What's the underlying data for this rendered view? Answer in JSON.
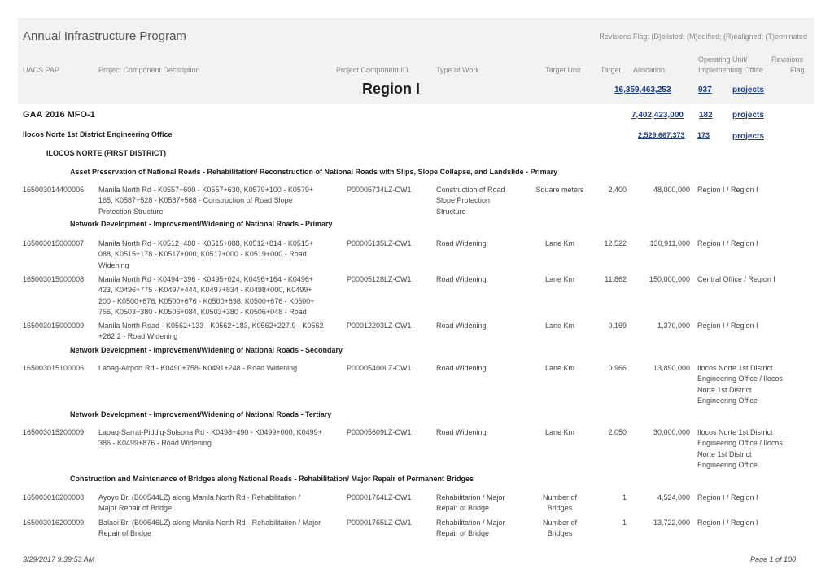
{
  "header": {
    "title": "Annual Infrastructure Program",
    "revisions_note": "Revisions Flag: (D)elisted; (M)odified; (R)ealigned; (T)erminated",
    "columns": {
      "uacs": "UACS PAP",
      "desc": "Project Component Decsription",
      "pcid": "Project Component ID",
      "work": "Type of Work",
      "unit": "Target Unit",
      "target": "Target",
      "alloc": "Allocation",
      "opunit": "Operating Unit/",
      "impl": "Implementing Office",
      "rev": "Revisions",
      "flag": "Flag"
    },
    "region": "Region I",
    "region_amount": "16,359,463,253",
    "region_count": "937",
    "region_link": "projects"
  },
  "gaa": {
    "label": "GAA 2016 MFO-1",
    "amount": "7,402,423,000",
    "count": "182",
    "link": "projects"
  },
  "office": {
    "label": "Ilocos Norte 1st District Engineering Office",
    "amount": "2,529,667,373",
    "count": "173",
    "link": "projects"
  },
  "district": "ILOCOS NORTE (FIRST DISTRICT)",
  "sections": {
    "s1": "Asset Preservation of National Roads - Rehabilitation/ Reconstruction of National Roads with Slips, Slope Collapse, and Landslide - Primary",
    "s2": "Network Development - Improvement/Widening of National Roads - Primary",
    "s3": "Network Development - Improvement/Widening of National Roads - Secondary",
    "s4": "Network Development - Improvement/Widening of National Roads - Tertiary",
    "s5": "Construction and Maintenance of Bridges along National Roads - Rehabilitation/ Major Repair of Permanent Bridges"
  },
  "rows": [
    {
      "uacs": "165003014400005",
      "desc": [
        "Manila North Rd - K0557+600 - K0557+630, K0579+100 - K0579+",
        "165, K0587+528 - K0587+568 - Construction of Road Slope",
        "Protection Structure"
      ],
      "pcid": "P00005734LZ-CW1",
      "work": [
        "Construction of Road",
        "Slope Protection",
        "Structure"
      ],
      "unit": [
        "Square meters"
      ],
      "target": "2,400",
      "alloc": "48,000,000",
      "impl": [
        "Region I / Region I"
      ]
    },
    {
      "uacs": "165003015000007",
      "desc": [
        "Manila North Rd - K0512+488 - K0515+088, K0512+814 - K0515+",
        "088, K0515+178 - K0517+000, K0517+000 - K0519+000 - Road",
        "Widening"
      ],
      "pcid": "P00005135LZ-CW1",
      "work": [
        "Road Widening"
      ],
      "unit": [
        "Lane Km"
      ],
      "target": "12.522",
      "alloc": "130,911,000",
      "impl": [
        "Region I / Region I"
      ]
    },
    {
      "uacs": "165003015000008",
      "desc": [
        "Manila North Rd - K0494+396 - K0495+024, K0496+164 - K0496+",
        "423, K0496+775 - K0497+444, K0497+834 - K0498+000, K0499+",
        "200 - K0500+676,  K0500+676 - K0500+698, K0500+676 - K0500+",
        "756, K0503+380 - K0506+084, K0503+380 - K0506+048 - Road"
      ],
      "pcid": "P00005128LZ-CW1",
      "work": [
        "Road Widening"
      ],
      "unit": [
        "Lane Km"
      ],
      "target": "11.862",
      "alloc": "150,000,000",
      "impl": [
        "Central Office / Region I"
      ]
    },
    {
      "uacs": "165003015000009",
      "desc": [
        "Manila North Road - K0562+133 - K0562+183, K0562+227.9 - K0562",
        "+262.2 - Road Widening"
      ],
      "pcid": "P00012203LZ-CW1",
      "work": [
        "Road Widening"
      ],
      "unit": [
        "Lane Km"
      ],
      "target": "0.169",
      "alloc": "1,370,000",
      "impl": [
        "Region I / Region I"
      ]
    },
    {
      "uacs": "165003015100006",
      "desc": [
        "Laoag-Airport Rd  - K0490+758- K0491+248 - Road Widening"
      ],
      "pcid": "P00005400LZ-CW1",
      "work": [
        "Road Widening"
      ],
      "unit": [
        "Lane Km"
      ],
      "target": "0.966",
      "alloc": "13,890,000",
      "impl": [
        "Ilocos Norte 1st District",
        "Engineering Office / Ilocos",
        "Norte 1st District",
        "Engineering Office"
      ]
    },
    {
      "uacs": "165003015200009",
      "desc": [
        "Laoag-Sarrat-Piddig-Solsona Rd  - K0498+490 - K0499+000, K0499+",
        "386 - K0499+876 - Road Widening"
      ],
      "pcid": "P00005609LZ-CW1",
      "work": [
        "Road Widening"
      ],
      "unit": [
        "Lane Km"
      ],
      "target": "2.050",
      "alloc": "30,000,000",
      "impl": [
        "Ilocos Norte 1st District",
        "Engineering Office / Ilocos",
        "Norte 1st District",
        "Engineering Office"
      ]
    },
    {
      "uacs": "165003016200008",
      "desc": [
        "Ayoyo Br. (B00544LZ) along Manila North Rd - Rehabilitation /",
        "Major Repair of Bridge"
      ],
      "pcid": "P00001764LZ-CW1",
      "work": [
        "Rehabilitation / Major",
        "Repair of Bridge"
      ],
      "unit": [
        "Number of",
        "Bridges"
      ],
      "target": "1",
      "alloc": "4,524,000",
      "impl": [
        "Region I / Region I"
      ]
    },
    {
      "uacs": "165003016200009",
      "desc": [
        "Balaoi Br. (B00546LZ) along Manila North Rd - Rehabilitation / Major",
        "Repair of Bridge"
      ],
      "pcid": "P00001765LZ-CW1",
      "work": [
        "Rehabilitation / Major",
        "Repair of Bridge"
      ],
      "unit": [
        "Number of",
        "Bridges"
      ],
      "target": "1",
      "alloc": "13,722,000",
      "impl": [
        "Region I / Region I"
      ]
    }
  ],
  "footer": {
    "timestamp": "3/29/2017  9:39:53 AM",
    "page": "Page 1 of 100"
  }
}
